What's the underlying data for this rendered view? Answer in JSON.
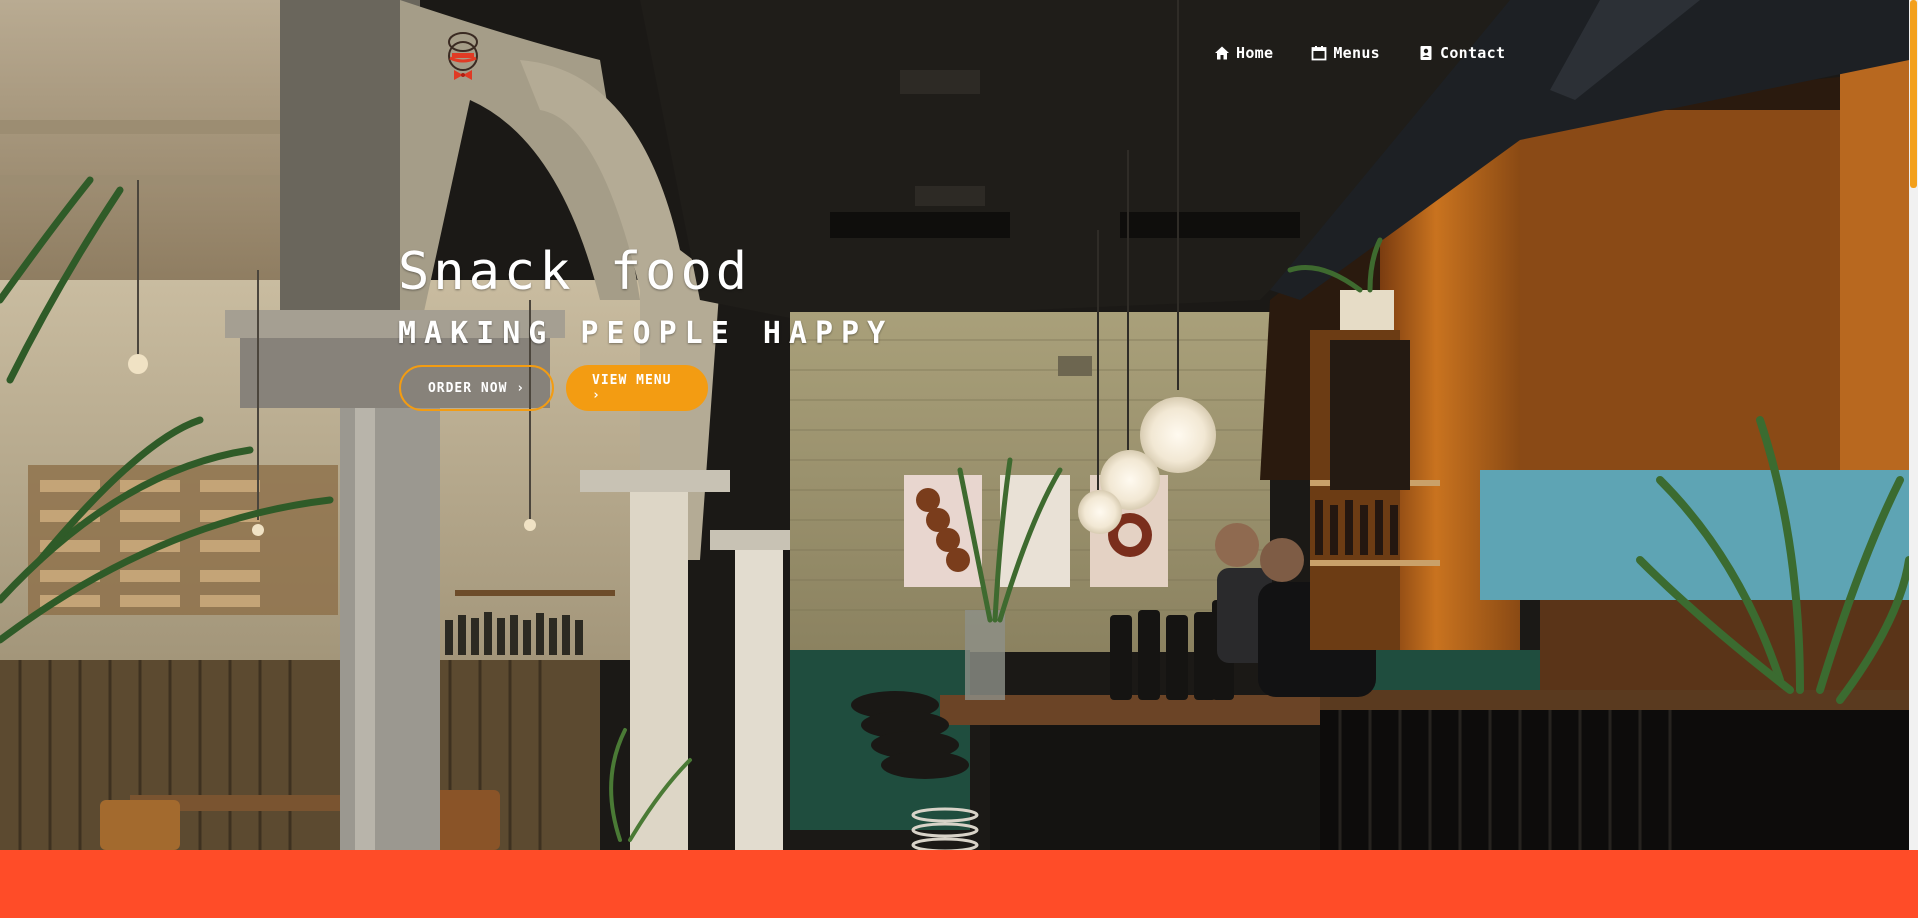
{
  "nav": {
    "items": [
      {
        "label": "Home",
        "icon": "home-icon"
      },
      {
        "label": "Menus",
        "icon": "calendar-icon"
      },
      {
        "label": "Contact",
        "icon": "contact-card-icon"
      }
    ]
  },
  "hero": {
    "title": "Snack food",
    "subtitle": "Making people happy",
    "order_button": "Order now ›",
    "menu_button": "View menu ›"
  },
  "colors": {
    "accent": "#f39c12",
    "bottom_band": "#ff4c28",
    "text": "#ffffff"
  }
}
